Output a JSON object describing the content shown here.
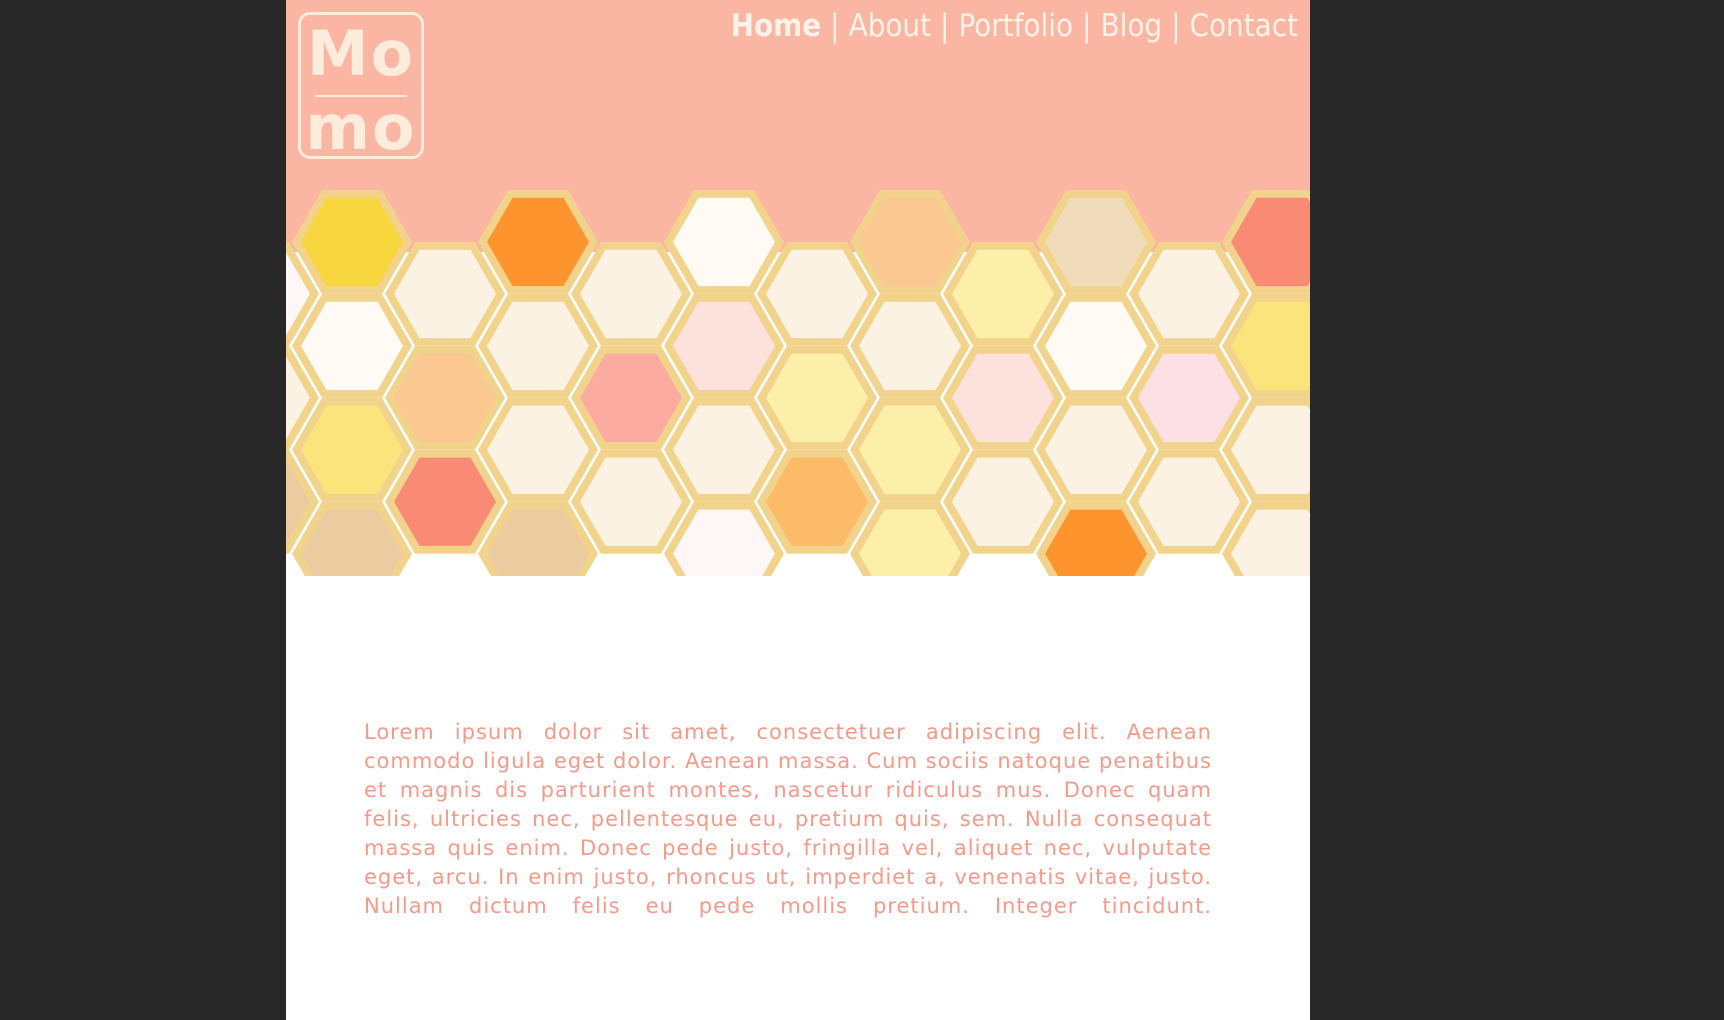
{
  "brand": {
    "logo_line_1": "Mo",
    "logo_line_2": "mo"
  },
  "nav": {
    "items": [
      {
        "label": "Home",
        "active": true
      },
      {
        "label": "About",
        "active": false
      },
      {
        "label": "Portfolio",
        "active": false
      },
      {
        "label": "Blog",
        "active": false
      },
      {
        "label": "Contact",
        "active": false
      }
    ],
    "separator": "|"
  },
  "content": {
    "body": "Lorem ipsum dolor sit amet, consectetuer adipiscing elit. Aenean commodo ligula eget dolor. Aenean massa. Cum sociis natoque penatibus et magnis dis parturient montes, nascetur ridiculus mus. Donec quam felis, ultricies nec, pellentesque eu, pretium quis, sem. Nulla consequat massa quis enim. Donec pede justo, fringilla vel, aliquet nec, vulputate eget, arcu. In enim justo, rhoncus ut, imperdiet a, venenatis vitae, justo. Nullam dictum felis eu pede mollis pretium. Integer tincidunt."
  },
  "colors": {
    "page_background": "#282828",
    "header_background": "#fbb5a3",
    "logo_and_nav": "#fdecdc",
    "hex_border": "#f2d38c",
    "body_text": "#f79a8a",
    "hex_fills": [
      "#f8d63e",
      "#fd942e",
      "#fffaf3",
      "#fcc891",
      "#f0dcba",
      "#f98a73",
      "#fcf2e4",
      "#fbefa9",
      "#fde1dc",
      "#fbe47b",
      "#fcaba0",
      "#fcbb68",
      "#fde0e6",
      "#ebcca1",
      "#fff6f7"
    ]
  },
  "hexagons": {
    "columns": [
      {
        "fills": [
          "#f8d63e",
          "#fffaf3",
          "#fbe47b",
          "#ebcca1"
        ]
      },
      {
        "fills": [
          "#fcf2e4",
          "#fcc891",
          "#f98a73"
        ]
      },
      {
        "fills": [
          "#fd942e",
          "#fcf2e4",
          "#fcf2e4",
          "#ebcca1"
        ]
      },
      {
        "fills": [
          "#fcf2e4",
          "#fcaba0",
          "#fcf2e4"
        ]
      },
      {
        "fills": [
          "#fffaf3",
          "#fde1dc",
          "#fcf2e4",
          "#fff6f7"
        ]
      },
      {
        "fills": [
          "#fcf2e4",
          "#fbefa9",
          "#fcbb68"
        ]
      },
      {
        "fills": [
          "#fcc891",
          "#fcf2e4",
          "#fbefa9",
          "#fbefa9"
        ]
      },
      {
        "fills": [
          "#fbefa9",
          "#fde1dc",
          "#fcf2e4"
        ]
      },
      {
        "fills": [
          "#f0dcba",
          "#fffaf3",
          "#fcf2e4",
          "#fd942e"
        ]
      },
      {
        "fills": [
          "#fcf2e4",
          "#fde0e6",
          "#fcf2e4"
        ]
      },
      {
        "fills": [
          "#f98a73",
          "#fbe47b",
          "#fcf2e4",
          "#fcf2e4"
        ]
      },
      {
        "fills": [
          "#fcf2e4",
          "#fcf2e4",
          "#fcf2e4"
        ]
      }
    ]
  }
}
